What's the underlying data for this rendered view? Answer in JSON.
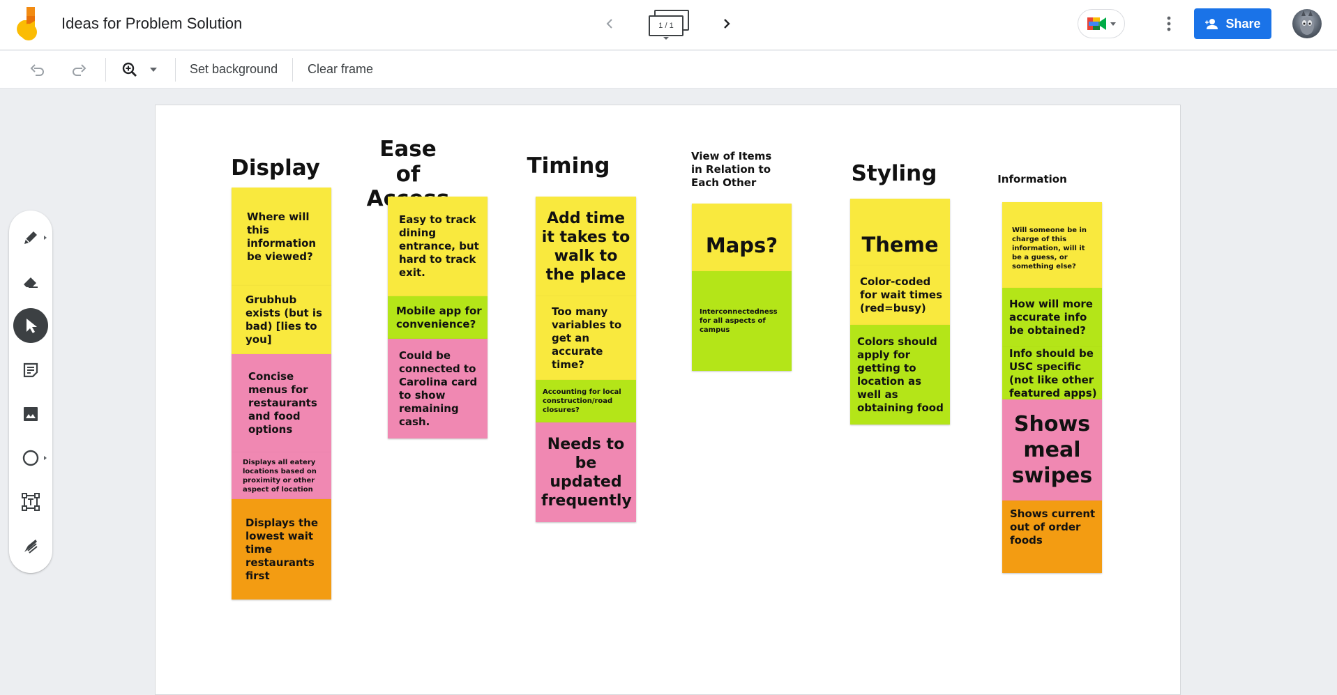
{
  "app": {
    "title": "Ideas for Problem Solution",
    "frame_indicator": "1 / 1",
    "share_label": "Share"
  },
  "toolbar": {
    "set_background": "Set background",
    "clear_frame": "Clear frame"
  },
  "colors": {
    "yellow": "#f9e93e",
    "green": "#b4e518",
    "pink": "#f088b2",
    "orange": "#f39c12",
    "share_blue": "#1a73e8"
  },
  "tools": [
    "pen-icon",
    "eraser-icon",
    "select-icon",
    "sticky-note-icon",
    "image-icon",
    "circle-icon",
    "text-box-icon",
    "laser-icon"
  ],
  "board": {
    "headings": {
      "display": "Display",
      "ease_of_access": "Ease of Access",
      "timing": "Timing",
      "view_items": "View of Items in Relation to Each Other",
      "styling": "Styling",
      "information": "Information"
    },
    "notes": {
      "display_1": "Where will this information be viewed?",
      "display_2": "Grubhub exists (but is bad) [lies to you]",
      "display_3": "Concise menus for restaurants and food options",
      "display_4": "Displays all eatery locations based on proximity or other aspect of location",
      "display_5": "Displays the lowest wait time restaurants first",
      "access_1": "Easy to track dining entrance, but hard to track exit.",
      "access_2": "Mobile app for convenience?",
      "access_3": "Could be connected to Carolina card to show remaining cash.",
      "timing_1": "Add time it takes to walk to the place",
      "timing_2": "Too many variables to get an accurate time?",
      "timing_3": "Accounting for local construction/road closures?",
      "timing_4": "Needs to be updated frequently",
      "view_1": "Maps?",
      "view_2": "Interconnectedness for all aspects of campus",
      "styling_1": "Theme",
      "styling_2": "Color-coded for wait times (red=busy)",
      "styling_3": "Colors should apply for getting to location as well as obtaining food",
      "info_1": "Will someone be in charge of this information, will it be a guess, or something else?",
      "info_2": "How will more accurate info be obtained?",
      "info_3": "Info should be USC specific (not like other featured apps)",
      "info_4": "Shows meal swipes",
      "info_5": "Shows current out of order foods"
    }
  }
}
